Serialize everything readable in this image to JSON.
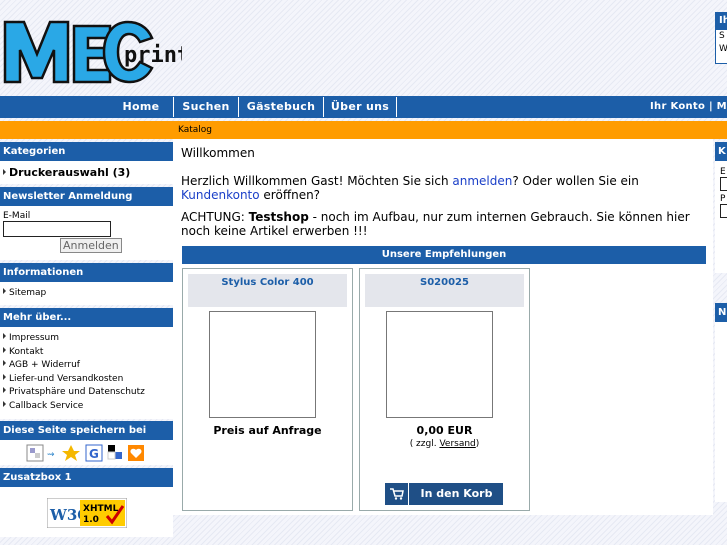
{
  "logo": {
    "main": "MEC",
    "sub": "print"
  },
  "account_box": {
    "title": "Ih",
    "line1": "S",
    "line2": "W"
  },
  "nav": {
    "home": "Home",
    "search": "Suchen",
    "guestbook": "Gästebuch",
    "about": "Über uns",
    "account": "Ihr Konto | M"
  },
  "breadcrumb": "Katalog",
  "left": {
    "categories_title": "Kategorien",
    "category": "Druckerauswahl (3)",
    "newsletter_title": "Newsletter Anmeldung",
    "email_label": "E-Mail",
    "email_value": "",
    "subscribe_button": "Anmelden",
    "info_title": "Informationen",
    "sitemap": "Sitemap",
    "more_title": "Mehr über...",
    "more_links": [
      "Impressum",
      "Kontakt",
      "AGB + Widerruf",
      "Liefer-und Versandkosten",
      "Privatsphäre und Datenschutz",
      "Callback Service"
    ],
    "bookmark_title": "Diese Seite speichern bei",
    "extra_title": "Zusatzbox 1",
    "w3c_badge": "W3C XHTML 1.0"
  },
  "main": {
    "welcome": "Willkommen",
    "greeting_a": "Herzlich Willkommen Gast! Möchten Sie sich ",
    "greeting_login": "anmelden",
    "greeting_b": "? Oder wollen Sie ein ",
    "greeting_account": "Kundenkonto",
    "greeting_c": " eröffnen?",
    "warning_prefix": "ACHTUNG: ",
    "warning_bold": "Testshop",
    "warning_text": " - noch im Aufbau, nur zum internen Gebrauch. Sie können hier noch keine Artikel erwerben !!!",
    "recommend_title": "Unsere Empfehlungen",
    "products": [
      {
        "name": "Stylus Color 400",
        "price": "Preis auf Anfrage"
      },
      {
        "name": "S020025",
        "price": "0,00 EUR",
        "shipping_a": "( zzgl. ",
        "shipping_link": "Versand",
        "shipping_b": ")",
        "cart_button": "In den Korb"
      }
    ]
  },
  "right": {
    "box1_title": "K",
    "label1": "E",
    "label2": "P",
    "box2_title": "N"
  },
  "colors": {
    "nav_blue": "#1c5ea8",
    "orange": "#ff9c00"
  }
}
